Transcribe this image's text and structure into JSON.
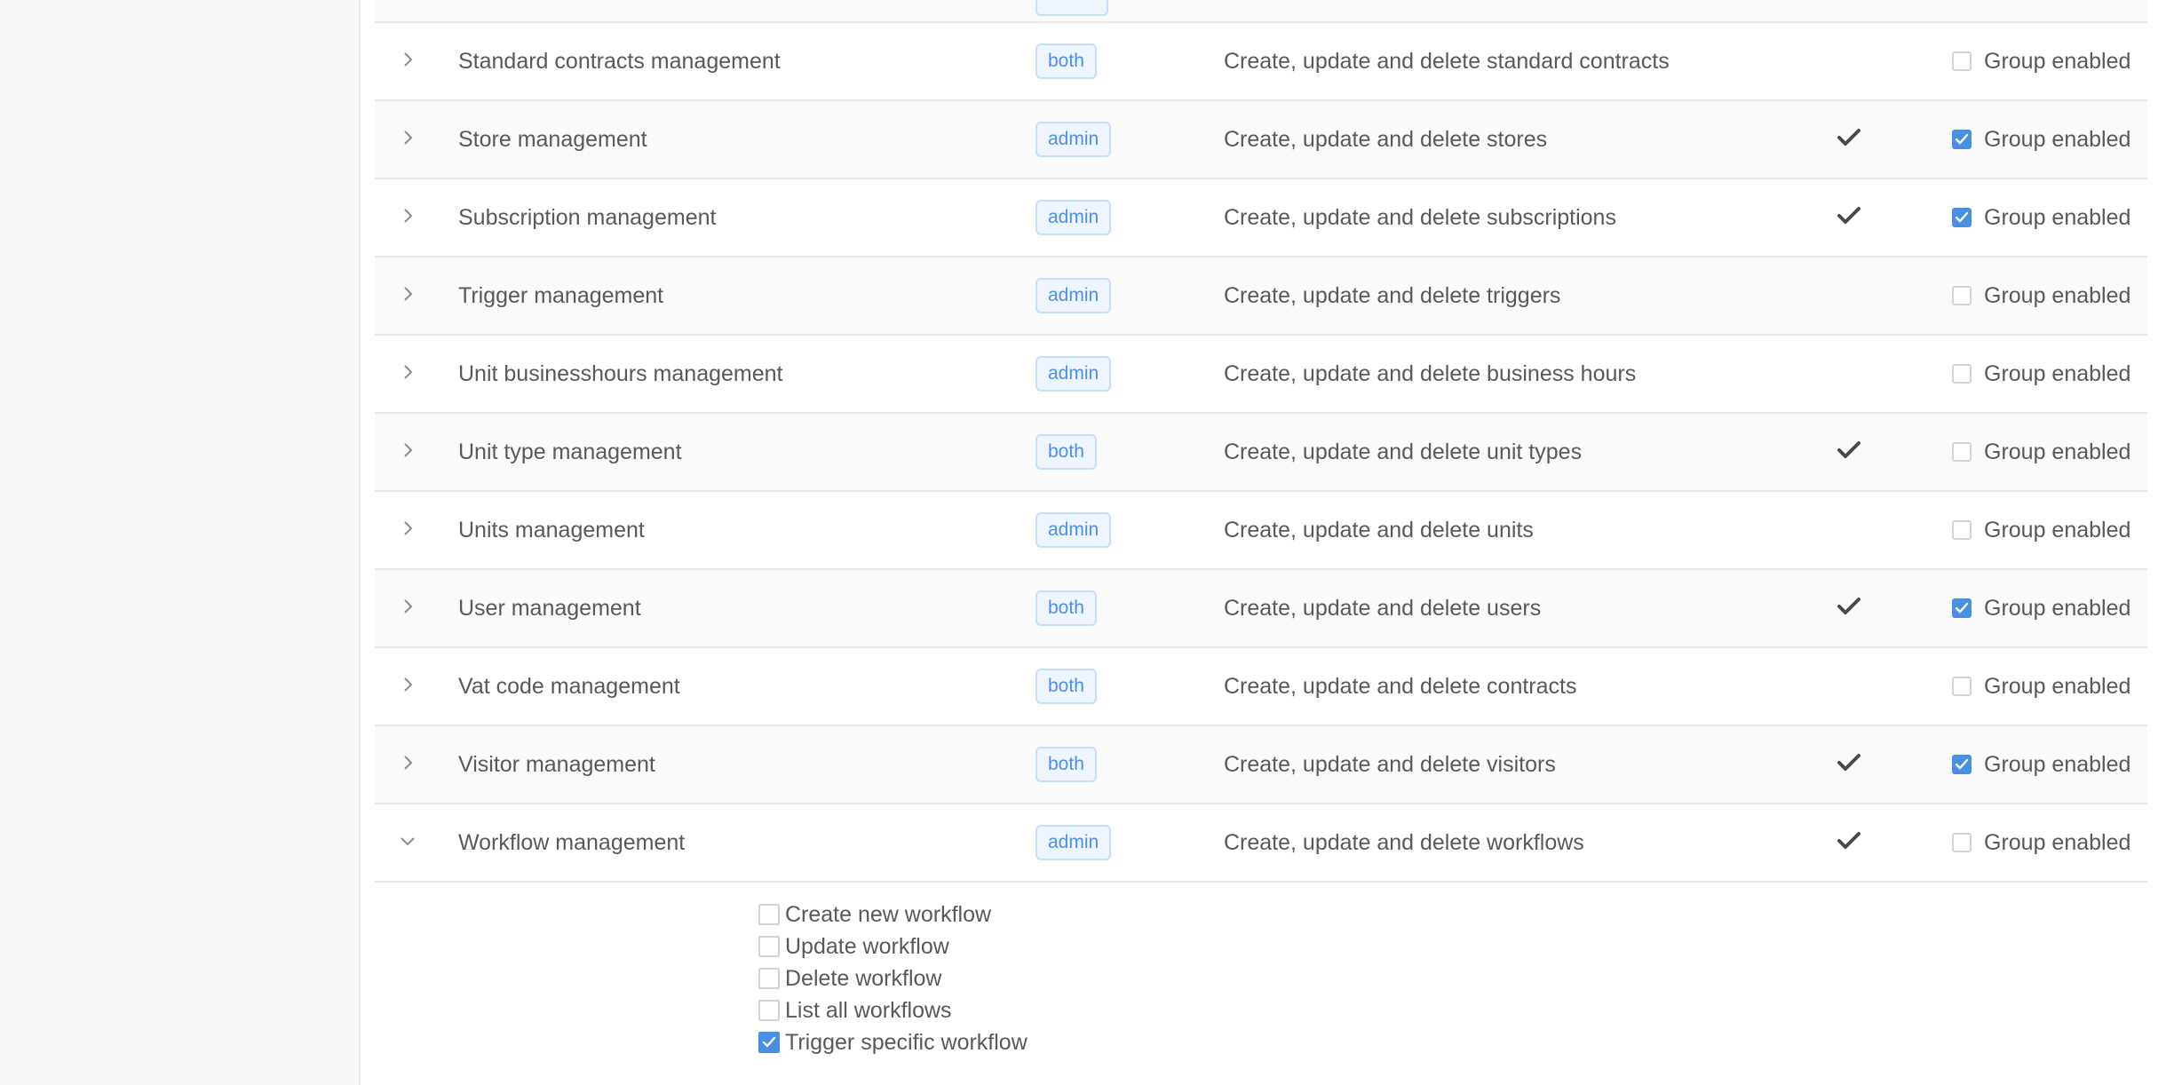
{
  "rows": [
    {
      "name": "Standard contracts management",
      "role": "both",
      "description": "Create, update and delete standard contracts",
      "default_checked": false,
      "group_enabled": false,
      "group_label": "Group enabled",
      "expanded": false
    },
    {
      "name": "Store management",
      "role": "admin",
      "description": "Create, update and delete stores",
      "default_checked": true,
      "group_enabled": true,
      "group_label": "Group enabled",
      "expanded": false
    },
    {
      "name": "Subscription management",
      "role": "admin",
      "description": "Create, update and delete subscriptions",
      "default_checked": true,
      "group_enabled": true,
      "group_label": "Group enabled",
      "expanded": false
    },
    {
      "name": "Trigger management",
      "role": "admin",
      "description": "Create, update and delete triggers",
      "default_checked": false,
      "group_enabled": false,
      "group_label": "Group enabled",
      "expanded": false
    },
    {
      "name": "Unit businesshours management",
      "role": "admin",
      "description": "Create, update and delete business hours",
      "default_checked": false,
      "group_enabled": false,
      "group_label": "Group enabled",
      "expanded": false
    },
    {
      "name": "Unit type management",
      "role": "both",
      "description": "Create, update and delete unit types",
      "default_checked": true,
      "group_enabled": false,
      "group_label": "Group enabled",
      "expanded": false
    },
    {
      "name": "Units management",
      "role": "admin",
      "description": "Create, update and delete units",
      "default_checked": false,
      "group_enabled": false,
      "group_label": "Group enabled",
      "expanded": false
    },
    {
      "name": "User management",
      "role": "both",
      "description": "Create, update and delete users",
      "default_checked": true,
      "group_enabled": true,
      "group_label": "Group enabled",
      "expanded": false
    },
    {
      "name": "Vat code management",
      "role": "both",
      "description": "Create, update and delete contracts",
      "default_checked": false,
      "group_enabled": false,
      "group_label": "Group enabled",
      "expanded": false
    },
    {
      "name": "Visitor management",
      "role": "both",
      "description": "Create, update and delete visitors",
      "default_checked": true,
      "group_enabled": true,
      "group_label": "Group enabled",
      "expanded": false
    },
    {
      "name": "Workflow management",
      "role": "admin",
      "description": "Create, update and delete workflows",
      "default_checked": true,
      "group_enabled": false,
      "group_label": "Group enabled",
      "expanded": true
    }
  ],
  "expanded_permissions": [
    {
      "label": "Create new workflow",
      "checked": false
    },
    {
      "label": "Update workflow",
      "checked": false
    },
    {
      "label": "Delete workflow",
      "checked": false
    },
    {
      "label": "List all workflows",
      "checked": false
    },
    {
      "label": "Trigger specific workflow",
      "checked": true
    }
  ],
  "colors": {
    "accent": "#4a90e2",
    "badge_text": "#4f8fe3",
    "badge_bg": "#eef5fe",
    "badge_border": "#c9def8",
    "text": "#595959",
    "sidebar_bg": "#f7f8fa",
    "row_alt_bg": "#fafafa"
  },
  "icons": {
    "collapsed": "chevron-right-icon",
    "expanded": "chevron-down-icon",
    "default_check": "checkmark-icon"
  }
}
